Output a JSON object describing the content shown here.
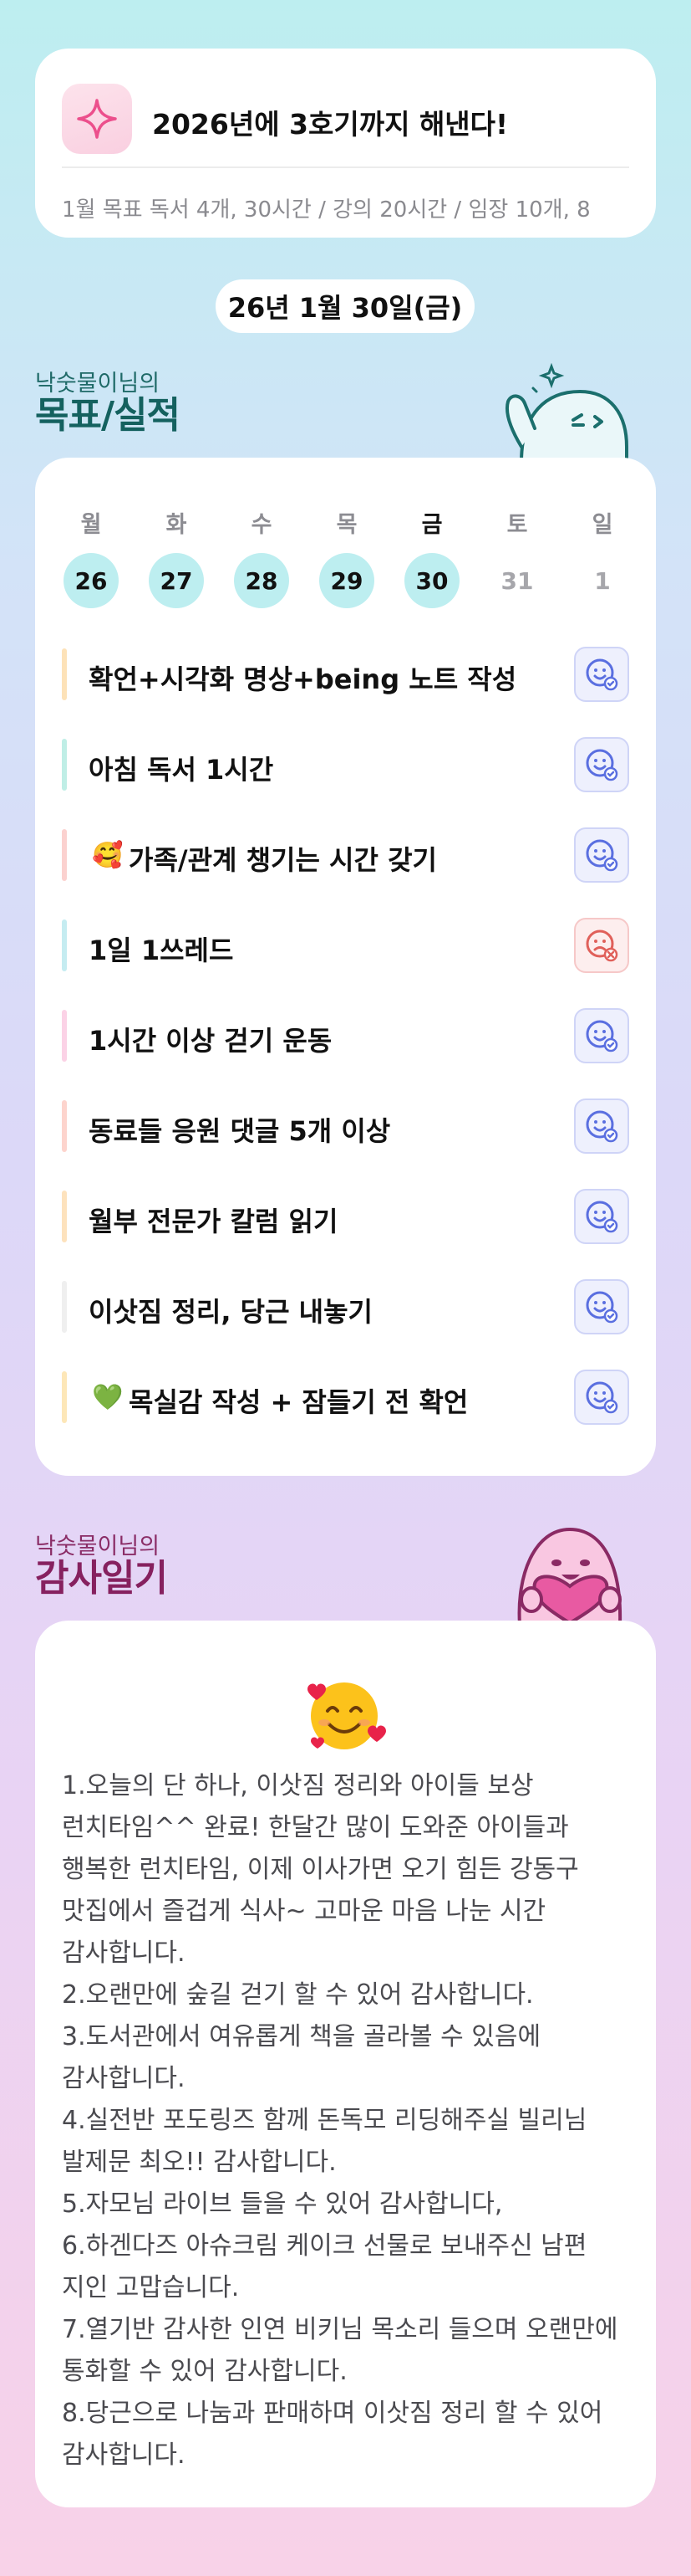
{
  "goal": {
    "title": "2026년에 3호기까지 해낸다!",
    "subtitle": "1월 목표  독서 4개, 30시간 / 강의 20시간 / 임장 10개, 8",
    "icon": "sparkle-icon"
  },
  "date": "26년 1월 30일(금)",
  "goals_section": {
    "owner_line": "낙숫물이님의",
    "title": "목표/실적"
  },
  "week": [
    {
      "name": "월",
      "num": "26",
      "state": "filled"
    },
    {
      "name": "화",
      "num": "27",
      "state": "filled"
    },
    {
      "name": "수",
      "num": "28",
      "state": "filled"
    },
    {
      "name": "목",
      "num": "29",
      "state": "filled"
    },
    {
      "name": "금",
      "num": "30",
      "state": "today"
    },
    {
      "name": "토",
      "num": "31",
      "state": "empty"
    },
    {
      "name": "일",
      "num": "1",
      "state": "empty"
    }
  ],
  "tasks": [
    {
      "label": "확언+시각화 명상+being 노트 작성",
      "color": "#fde2b8",
      "status": "done",
      "emoji": ""
    },
    {
      "label": "아침 독서 1시간",
      "color": "#bfeee6",
      "status": "done",
      "emoji": ""
    },
    {
      "label": "가족/관계 챙기는 시간 갖기",
      "color": "#fbd1cf",
      "status": "done",
      "emoji": "🥰"
    },
    {
      "label": "1일 1쓰레드",
      "color": "#c5ecf1",
      "status": "fail",
      "emoji": ""
    },
    {
      "label": "1시간 이상 걷기 운동",
      "color": "#fbd2e6",
      "status": "done",
      "emoji": ""
    },
    {
      "label": "동료들 응원 댓글 5개 이상",
      "color": "#fdd4cd",
      "status": "done",
      "emoji": ""
    },
    {
      "label": "월부 전문가 칼럼 읽기",
      "color": "#fde2bd",
      "status": "done",
      "emoji": ""
    },
    {
      "label": "이삿짐 정리, 당근 내놓기",
      "color": "#efefef",
      "status": "done",
      "emoji": ""
    },
    {
      "label": "목실감 작성 + 잠들기 전 확언",
      "color": "#fde7b8",
      "status": "done",
      "emoji": "💚"
    }
  ],
  "gratitude_section": {
    "owner_line": "낙숫물이님의",
    "title": "감사일기"
  },
  "gratitude": {
    "emoji": "smiling-face-with-hearts",
    "text": "1.오늘의 단 하나, 이삿짐 정리와 아이들 보상 런치타임^^ 완료! 한달간 많이 도와준 아이들과 행복한 런치타임, 이제 이사가면 오기 힘든 강동구 맛집에서 즐겁게 식사~ 고마운 마음 나눈 시간 감사합니다.\n2.오랜만에 숲길 걷기 할 수 있어 감사합니다.\n3.도서관에서 여유롭게 책을 골라볼 수 있음에 감사합니다.\n4.실전반 포도링즈 함께 돈독모 리딩해주실 빌리님 발제문 최오!! 감사합니다.\n5.자모님 라이브 들을 수 있어 감사합니다,\n6.하겐다즈 아슈크림 케이크 선물로 보내주신 남편 지인 고맙습니다.\n7.열기반 감사한 인연 비키님 목소리 들으며 오랜만에 통화할 수 있어 감사합니다.\n8.당근으로 나눔과 판매하며 이삿짐 정리 할 수 있어 감사합니다."
  },
  "colors": {
    "accent_teal": "#14615f",
    "accent_pink": "#86215f",
    "day_fill": "#bdeef0",
    "status_done": "#5a6fe0",
    "status_fail": "#e0605a"
  }
}
